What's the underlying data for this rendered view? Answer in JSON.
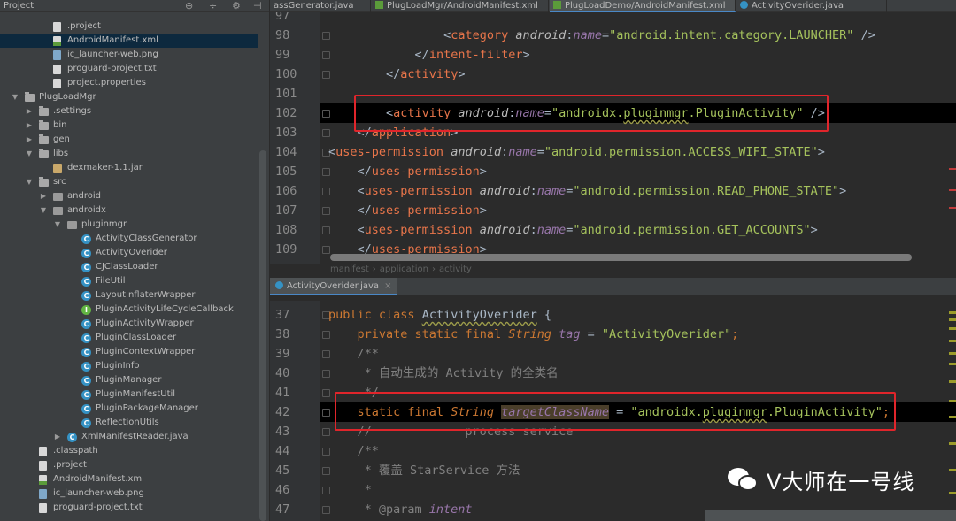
{
  "project_panel": {
    "title": "Project",
    "rows": [
      {
        "label": ".project",
        "icon": "file",
        "depth": 2
      },
      {
        "label": "AndroidManifest.xml",
        "icon": "xml",
        "depth": 2,
        "selected": true
      },
      {
        "label": "ic_launcher-web.png",
        "icon": "img",
        "depth": 2
      },
      {
        "label": "proguard-project.txt",
        "icon": "file",
        "depth": 2
      },
      {
        "label": "project.properties",
        "icon": "file",
        "depth": 2
      },
      {
        "label": "PlugLoadMgr",
        "icon": "folder",
        "depth": 0,
        "arrow": "open"
      },
      {
        "label": ".settings",
        "icon": "folder",
        "depth": 1,
        "arrow": "closed"
      },
      {
        "label": "bin",
        "icon": "folder",
        "depth": 1,
        "arrow": "closed"
      },
      {
        "label": "gen",
        "icon": "folder",
        "depth": 1,
        "arrow": "closed"
      },
      {
        "label": "libs",
        "icon": "folder",
        "depth": 1,
        "arrow": "open"
      },
      {
        "label": "dexmaker-1.1.jar",
        "icon": "jar",
        "depth": 2
      },
      {
        "label": "src",
        "icon": "folder",
        "depth": 1,
        "arrow": "open"
      },
      {
        "label": "android",
        "icon": "pkg",
        "depth": 2,
        "arrow": "closed"
      },
      {
        "label": "androidx",
        "icon": "pkg",
        "depth": 2,
        "arrow": "open"
      },
      {
        "label": "pluginmgr",
        "icon": "pkg",
        "depth": 3,
        "arrow": "open"
      },
      {
        "label": "ActivityClassGenerator",
        "icon": "cls",
        "depth": 4
      },
      {
        "label": "ActivityOverider",
        "icon": "cls",
        "depth": 4
      },
      {
        "label": "CJClassLoader",
        "icon": "cls",
        "depth": 4
      },
      {
        "label": "FileUtil",
        "icon": "cls",
        "depth": 4
      },
      {
        "label": "LayoutInflaterWrapper",
        "icon": "cls",
        "depth": 4
      },
      {
        "label": "PluginActivityLifeCycleCallback",
        "icon": "ifc",
        "depth": 4
      },
      {
        "label": "PluginActivityWrapper",
        "icon": "cls",
        "depth": 4
      },
      {
        "label": "PluginClassLoader",
        "icon": "cls",
        "depth": 4
      },
      {
        "label": "PluginContextWrapper",
        "icon": "cls",
        "depth": 4
      },
      {
        "label": "PluginInfo",
        "icon": "cls",
        "depth": 4
      },
      {
        "label": "PluginManager",
        "icon": "cls",
        "depth": 4
      },
      {
        "label": "PluginManifestUtil",
        "icon": "cls",
        "depth": 4
      },
      {
        "label": "PluginPackageManager",
        "icon": "cls",
        "depth": 4
      },
      {
        "label": "ReflectionUtils",
        "icon": "cls",
        "depth": 4
      },
      {
        "label": "XmlManifestReader.java",
        "icon": "cls",
        "depth": 3,
        "arrow": "closed"
      },
      {
        "label": ".classpath",
        "icon": "file",
        "depth": 1
      },
      {
        "label": ".project",
        "icon": "file",
        "depth": 1
      },
      {
        "label": "AndroidManifest.xml",
        "icon": "xml",
        "depth": 1
      },
      {
        "label": "ic_launcher-web.png",
        "icon": "img",
        "depth": 1
      },
      {
        "label": "proguard-project.txt",
        "icon": "file",
        "depth": 1
      }
    ]
  },
  "top_tabs": [
    {
      "label": "assGenerator.java",
      "icon": "cls"
    },
    {
      "label": "PlugLoadMgr/AndroidManifest.xml",
      "icon": "xml"
    },
    {
      "label": "PlugLoadDemo/AndroidManifest.xml",
      "icon": "xml",
      "active": true
    },
    {
      "label": "ActivityOverider.java",
      "icon": "cls"
    }
  ],
  "top_editor": {
    "lines": [
      {
        "n": "97",
        "indent": 0,
        "parts": []
      },
      {
        "n": "98",
        "indent": 16,
        "parts": [
          [
            "p",
            "<"
          ],
          [
            "tag",
            "category"
          ],
          [
            "p",
            " "
          ],
          [
            "attr",
            "android"
          ],
          [
            "p",
            ":"
          ],
          [
            "ns",
            "name"
          ],
          [
            "p",
            "="
          ],
          [
            "val",
            "\"android.intent.category.LAUNCHER\""
          ],
          [
            "p",
            " />"
          ]
        ]
      },
      {
        "n": "99",
        "indent": 12,
        "parts": [
          [
            "p",
            "</"
          ],
          [
            "tag",
            "intent-filter"
          ],
          [
            "p",
            ">"
          ]
        ]
      },
      {
        "n": "100",
        "indent": 8,
        "parts": [
          [
            "p",
            "</"
          ],
          [
            "tag",
            "activity"
          ],
          [
            "p",
            ">"
          ]
        ]
      },
      {
        "n": "101",
        "indent": 0,
        "parts": []
      },
      {
        "n": "102",
        "indent": 8,
        "current": true,
        "parts": [
          [
            "p",
            "<"
          ],
          [
            "tag",
            "activity"
          ],
          [
            "p",
            " "
          ],
          [
            "attr",
            "android"
          ],
          [
            "p",
            ":"
          ],
          [
            "ns",
            "name"
          ],
          [
            "p",
            "="
          ],
          [
            "val",
            "\"androidx."
          ],
          [
            "valu",
            "pluginmgr"
          ],
          [
            "val",
            "."
          ],
          [
            "val",
            "PluginActivity\""
          ],
          [
            "p",
            " />"
          ]
        ]
      },
      {
        "n": "103",
        "indent": 4,
        "parts": [
          [
            "p",
            "</"
          ],
          [
            "tag",
            "application"
          ],
          [
            "p",
            ">"
          ]
        ]
      },
      {
        "n": "104",
        "indent": 0,
        "parts": [
          [
            "p",
            "<"
          ],
          [
            "tag",
            "uses-permission"
          ],
          [
            "p",
            " "
          ],
          [
            "attr",
            "android"
          ],
          [
            "p",
            ":"
          ],
          [
            "ns",
            "name"
          ],
          [
            "p",
            "="
          ],
          [
            "val",
            "\"android.permission.ACCESS_WIFI_STATE\""
          ],
          [
            "p",
            ">"
          ]
        ]
      },
      {
        "n": "105",
        "indent": 4,
        "parts": [
          [
            "p",
            "</"
          ],
          [
            "tag",
            "uses-permission"
          ],
          [
            "p",
            ">"
          ]
        ]
      },
      {
        "n": "106",
        "indent": 4,
        "parts": [
          [
            "p",
            "<"
          ],
          [
            "tag",
            "uses-permission"
          ],
          [
            "p",
            " "
          ],
          [
            "attr",
            "android"
          ],
          [
            "p",
            ":"
          ],
          [
            "ns",
            "name"
          ],
          [
            "p",
            "="
          ],
          [
            "val",
            "\"android.permission.READ_PHONE_STATE\""
          ],
          [
            "p",
            ">"
          ]
        ]
      },
      {
        "n": "107",
        "indent": 4,
        "parts": [
          [
            "p",
            "</"
          ],
          [
            "tag",
            "uses-permission"
          ],
          [
            "p",
            ">"
          ]
        ]
      },
      {
        "n": "108",
        "indent": 4,
        "parts": [
          [
            "p",
            "<"
          ],
          [
            "tag",
            "uses-permission"
          ],
          [
            "p",
            " "
          ],
          [
            "attr",
            "android"
          ],
          [
            "p",
            ":"
          ],
          [
            "ns",
            "name"
          ],
          [
            "p",
            "="
          ],
          [
            "val",
            "\"android.permission.GET_ACCOUNTS\""
          ],
          [
            "p",
            ">"
          ]
        ]
      },
      {
        "n": "109",
        "indent": 4,
        "parts": [
          [
            "p",
            "</"
          ],
          [
            "tag",
            "uses-permission"
          ],
          [
            "p",
            ">"
          ]
        ]
      }
    ]
  },
  "breadcrumb": [
    "manifest",
    "application",
    "activity"
  ],
  "bottom_tab": {
    "label": "ActivityOverider.java"
  },
  "bottom_editor": {
    "lines": [
      {
        "n": "37",
        "indent": 0,
        "parts": [
          [
            "kw",
            "public "
          ],
          [
            "kw",
            "class "
          ],
          [
            "cls",
            "ActivityOverider"
          ],
          [
            "p",
            " {"
          ]
        ]
      },
      {
        "n": "38",
        "indent": 4,
        "parts": [
          [
            "kw",
            "private "
          ],
          [
            "kw",
            "static "
          ],
          [
            "kw",
            "final "
          ],
          [
            "typ",
            "String "
          ],
          [
            "fld",
            "tag"
          ],
          [
            "p",
            " = "
          ],
          [
            "str",
            "\"ActivityOverider\""
          ],
          [
            "kw",
            ";"
          ]
        ]
      },
      {
        "n": "39",
        "indent": 4,
        "parts": [
          [
            "cmt",
            "/**"
          ]
        ]
      },
      {
        "n": "40",
        "indent": 4,
        "parts": [
          [
            "cmt",
            " * 自动生成的 Activity 的全类名"
          ]
        ]
      },
      {
        "n": "41",
        "indent": 4,
        "parts": [
          [
            "cmt",
            " */"
          ]
        ]
      },
      {
        "n": "42",
        "indent": 4,
        "current": true,
        "parts": [
          [
            "kw",
            "static "
          ],
          [
            "kw",
            "final "
          ],
          [
            "typ",
            "String "
          ],
          [
            "fldh",
            "targetClassName"
          ],
          [
            "p",
            " = "
          ],
          [
            "str",
            "\"androidx."
          ],
          [
            "stru",
            "pluginmgr"
          ],
          [
            "str",
            ".PluginActivity\""
          ],
          [
            "kw",
            ";"
          ]
        ]
      },
      {
        "n": "43",
        "indent": 4,
        "parts": [
          [
            "cmt",
            "//             process service"
          ]
        ]
      },
      {
        "n": "44",
        "indent": 4,
        "parts": [
          [
            "cmt",
            "/**"
          ]
        ]
      },
      {
        "n": "45",
        "indent": 4,
        "parts": [
          [
            "cmt",
            " * 覆盖 StarService 方法"
          ]
        ]
      },
      {
        "n": "46",
        "indent": 4,
        "parts": [
          [
            "cmt",
            " *"
          ]
        ]
      },
      {
        "n": "47",
        "indent": 4,
        "parts": [
          [
            "cmt",
            " * @param "
          ],
          [
            "fld",
            "intent"
          ]
        ]
      }
    ]
  },
  "watermark": {
    "text": "V大师在一号线"
  },
  "colors": {
    "accent": "#4a88c7",
    "highlight_box": "#e0252b"
  }
}
